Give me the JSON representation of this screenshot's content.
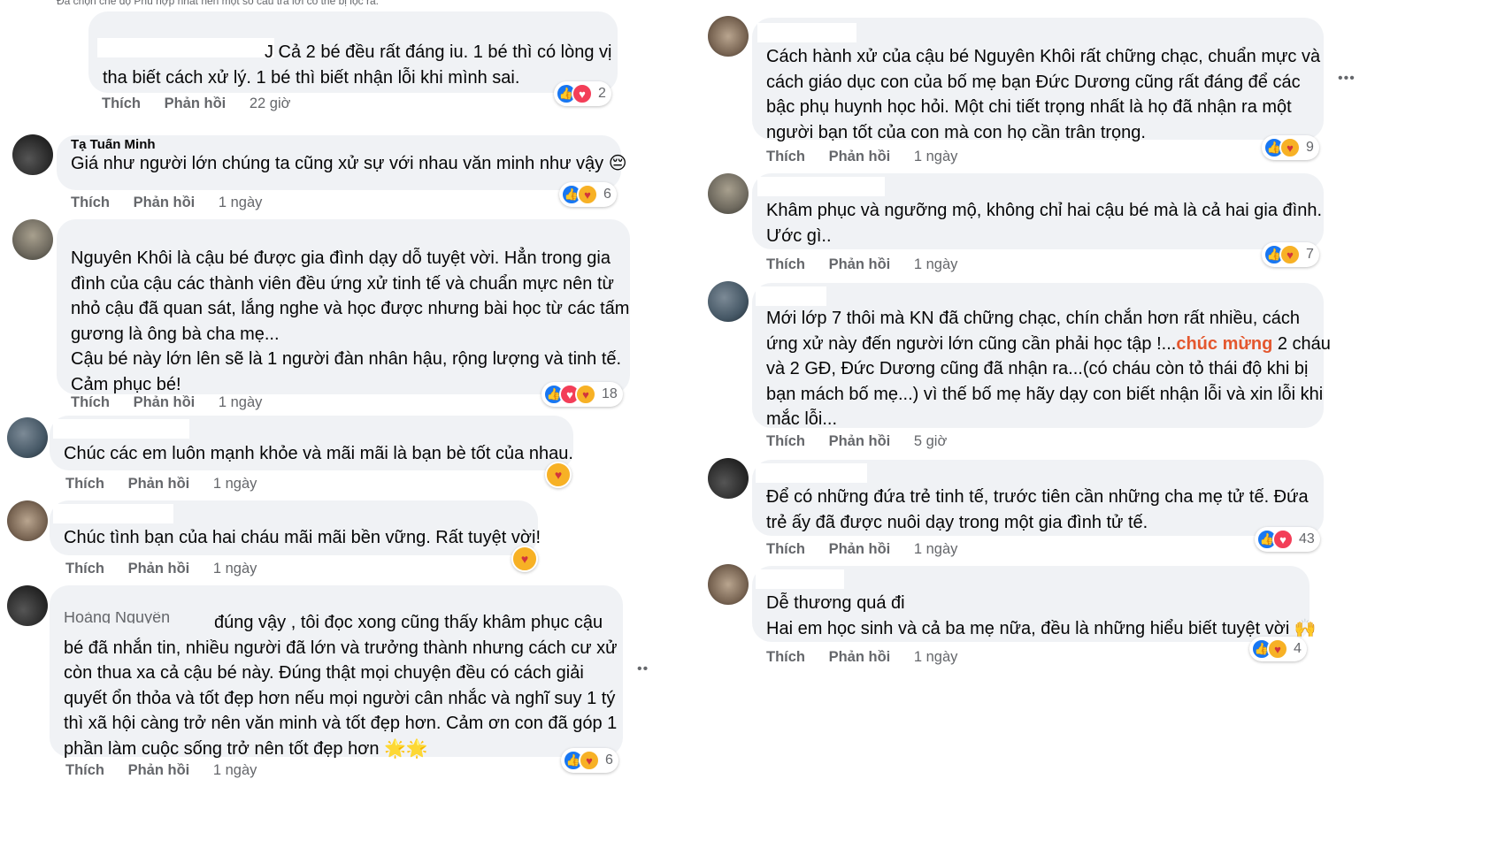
{
  "top_cut_text": "Đã chọn chế độ Phù hợp nhất nên một số câu trả lời có thể bị lọc ra.",
  "labels": {
    "like": "Thích",
    "reply": "Phản hồi"
  },
  "left": [
    {
      "name_text": "",
      "lines": [
        "J Cả 2 bé đều rất đáng iu. 1 bé thì có lòng vị",
        "tha biết cách xử lý. 1 bé thì biết nhận lỗi khi mình sai."
      ],
      "time": "22 giờ",
      "reaction_count": "2",
      "reactions": [
        "like",
        "love"
      ]
    },
    {
      "name_text": "Tạ Tuấn Minh",
      "lines": [
        "Giá như người lớn chúng ta cũng xử sự với nhau văn minh như vậy 😔"
      ],
      "time": "1 ngày",
      "reaction_count": "6",
      "reactions": [
        "like",
        "care"
      ]
    },
    {
      "name_text": "",
      "lines": [
        "Nguyên Khôi là cậu bé được gia đình dạy dỗ tuyệt vời. Hẳn trong gia",
        "đình của cậu các thành viên đều ứng xử tinh tế và chuẩn mực nên từ",
        "nhỏ cậu đã quan sát, lắng nghe và học được nhưng bài học từ các tấm",
        "gương là ông bà cha mẹ...",
        "Cậu bé này lớn lên sẽ là 1 người đàn nhân hậu, rộng lượng và tinh tế.",
        "Cảm phục bé!"
      ],
      "time": "1 ngày",
      "reaction_count": "18",
      "reactions": [
        "like",
        "love",
        "care"
      ]
    },
    {
      "name_text": "",
      "lines": [
        "Chúc các em luôn mạnh khỏe và mãi mãi là bạn bè tốt của nhau."
      ],
      "time": "1 ngày",
      "reaction_count": "",
      "reactions": [
        "care"
      ]
    },
    {
      "name_text": "",
      "lines": [
        "Chúc tình bạn của hai cháu mãi mãi bền vững. Rất tuyệt vời!"
      ],
      "time": "1 ngày",
      "reaction_count": "",
      "reactions": [
        "care"
      ]
    },
    {
      "name_text": "Hoàng Nguyễn",
      "lines": [
        "đúng vậy , tôi đọc xong cũng thấy khâm phục cậu",
        "bé đã nhắn tin, nhiều người đã lớn và trưởng thành nhưng cách cư xử",
        "còn thua xa cả cậu bé này. Đúng thật mọi chuyện đều có cách giải",
        "quyết ổn thỏa và tốt đẹp hơn nếu mọi người cân nhắc và nghĩ suy 1 tý",
        "thì xã hội càng trở nên văn minh và tốt đẹp hơn. Cảm ơn con đã góp 1",
        "phần làm cuộc sống trở nên tốt đẹp hơn 🌟🌟"
      ],
      "time": "1 ngày",
      "reaction_count": "6",
      "reactions": [
        "like",
        "care"
      ]
    }
  ],
  "right": [
    {
      "lines": [
        "Cách hành xử của cậu bé Nguyên Khôi rất chững chạc, chuẩn mực và",
        "cách giáo dục con của bố mẹ bạn Đức Dương cũng rất đáng để các",
        "bậc phụ huynh học hỏi. Một chi tiết trọng nhất là họ đã nhận ra một",
        "người bạn tốt của con mà con họ cần trân trọng."
      ],
      "time": "1 ngày",
      "reaction_count": "9",
      "reactions": [
        "like",
        "care"
      ]
    },
    {
      "lines": [
        "Khâm phục và ngưỡng mộ, không chỉ hai cậu bé mà là cả hai gia đình.",
        "Ước gì.."
      ],
      "time": "1 ngày",
      "reaction_count": "7",
      "reactions": [
        "like",
        "care"
      ]
    },
    {
      "lines_parts": [
        [
          "Mới lớp 7 thôi mà KN đã chững chạc, chín chắn hơn rất nhiều, cách"
        ],
        [
          "ứng xử này đến người lớn cũng cần phải học tập !...",
          "chúc mừng",
          " 2 cháu"
        ],
        [
          "và 2 GĐ, Đức Dương cũng đã nhận ra...(có cháu còn tỏ thái độ khi bị"
        ],
        [
          "bạn mách bố mẹ...) vì thế bố mẹ hãy dạy con biết nhận lỗi và xin lỗi khi"
        ],
        [
          "mắc lỗi..."
        ]
      ],
      "time": "5 giờ",
      "reaction_count": "",
      "reactions": []
    },
    {
      "lines": [
        "Để có những đứa trẻ tinh tế, trước tiên cần những cha mẹ tử tế. Đứa",
        "trẻ ấy đã được nuôi dạy trong một gia đình tử tế."
      ],
      "time": "1 ngày",
      "reaction_count": "43",
      "reactions": [
        "like",
        "love"
      ]
    },
    {
      "lines": [
        "Dễ thương quá đi",
        "Hai em học sinh và cả ba mẹ nữa, đều là những hiểu biết tuyệt vời 🙌"
      ],
      "time": "1 ngày",
      "reaction_count": "4",
      "reactions": [
        "like",
        "care"
      ]
    }
  ],
  "more_label": "•••",
  "colors": {
    "bubble": "#f0f2f5",
    "like": "#1877f2",
    "love": "#f33e58",
    "care": "#f7b125",
    "highlight": "#e4572e",
    "meta": "#65676b"
  }
}
